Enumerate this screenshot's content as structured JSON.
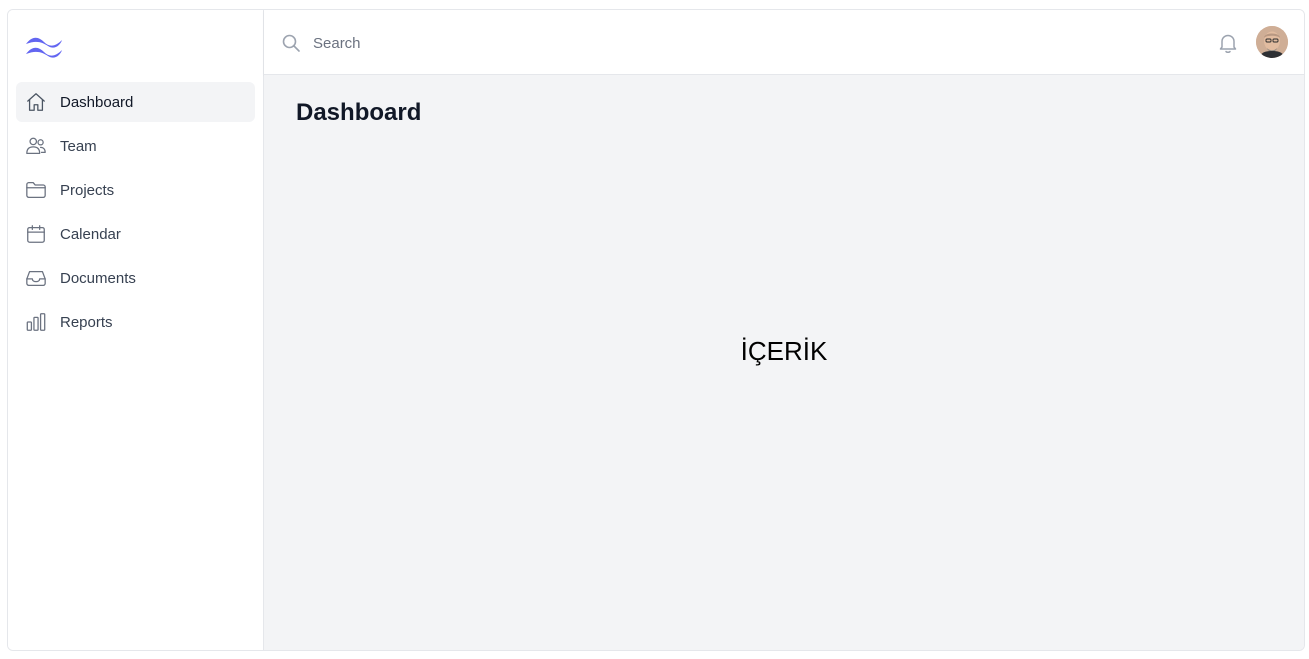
{
  "sidebar": {
    "logo_name": "tailwind-wave-logo",
    "items": [
      {
        "label": "Dashboard",
        "icon": "home-icon",
        "active": true
      },
      {
        "label": "Team",
        "icon": "users-icon",
        "active": false
      },
      {
        "label": "Projects",
        "icon": "folder-icon",
        "active": false
      },
      {
        "label": "Calendar",
        "icon": "calendar-icon",
        "active": false
      },
      {
        "label": "Documents",
        "icon": "inbox-icon",
        "active": false
      },
      {
        "label": "Reports",
        "icon": "bar-chart-icon",
        "active": false
      }
    ]
  },
  "topbar": {
    "search_placeholder": "Search",
    "notification_icon": "bell-icon",
    "avatar": "user-avatar"
  },
  "main": {
    "title": "Dashboard",
    "content_text": "İÇERİK"
  },
  "colors": {
    "brand": "#6366f1",
    "active_bg": "#f3f4f6",
    "main_bg": "#f3f4f6"
  }
}
